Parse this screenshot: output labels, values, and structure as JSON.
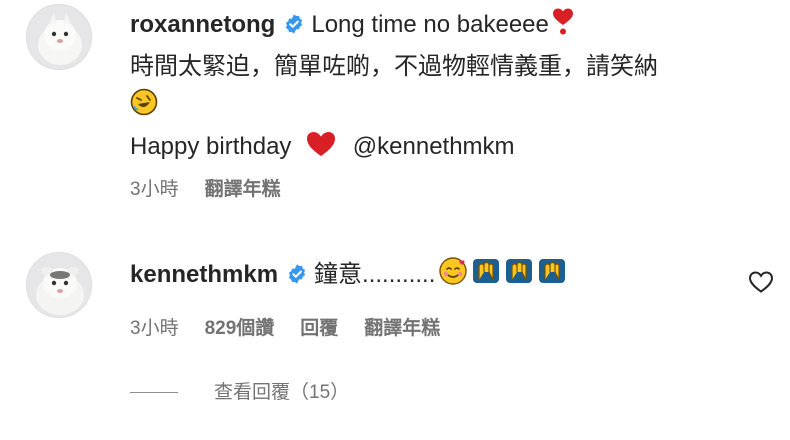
{
  "comments": [
    {
      "username": "roxannetong",
      "text": "Long time no bakeeee",
      "line2": "時間太緊迫，簡單咗啲，不過物輕情義重，請笑納",
      "line4_text": "Happy birthday",
      "mention": "@kennethmkm",
      "time": "3小時",
      "translate": "翻譯年糕"
    },
    {
      "username": "kennethmkm",
      "text": "鐘意...........",
      "time": "3小時",
      "likes": "829個讚",
      "reply": "回覆",
      "translate": "翻譯年糕"
    }
  ],
  "view_replies": "查看回覆（15）",
  "colors": {
    "verified": "#3897f0",
    "heart": "#e0245e",
    "meta": "#737373"
  }
}
